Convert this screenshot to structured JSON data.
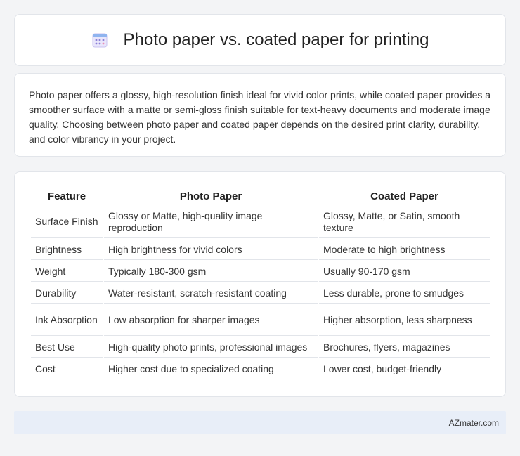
{
  "header": {
    "title": "Photo paper vs. coated paper for printing",
    "icon": "calendar-icon"
  },
  "intro": {
    "text": "Photo paper offers a glossy, high-resolution finish ideal for vivid color prints, while coated paper provides a smoother surface with a matte or semi-gloss finish suitable for text-heavy documents and moderate image quality. Choosing between photo paper and coated paper depends on the desired print clarity, durability, and color vibrancy in your project."
  },
  "table": {
    "headers": [
      "Feature",
      "Photo Paper",
      "Coated Paper"
    ],
    "rows": [
      [
        "Surface Finish",
        "Glossy or Matte, high-quality image reproduction",
        "Glossy, Matte, or Satin, smooth texture"
      ],
      [
        "Brightness",
        "High brightness for vivid colors",
        "Moderate to high brightness"
      ],
      [
        "Weight",
        "Typically 180-300 gsm",
        "Usually 90-170 gsm"
      ],
      [
        "Durability",
        "Water-resistant, scratch-resistant coating",
        "Less durable, prone to smudges"
      ],
      [
        "Ink Absorption",
        "Low absorption for sharper images",
        "Higher absorption, less sharpness"
      ],
      [
        "Best Use",
        "High-quality photo prints, professional images",
        "Brochures, flyers, magazines"
      ],
      [
        "Cost",
        "Higher cost due to specialized coating",
        "Lower cost, budget-friendly"
      ]
    ]
  },
  "footer": {
    "text": "AZmater.com"
  },
  "colors": {
    "background": "#f3f4f6",
    "card": "#ffffff",
    "footer_bg": "#e8eef8",
    "icon_accent": "#8b7fd6"
  }
}
